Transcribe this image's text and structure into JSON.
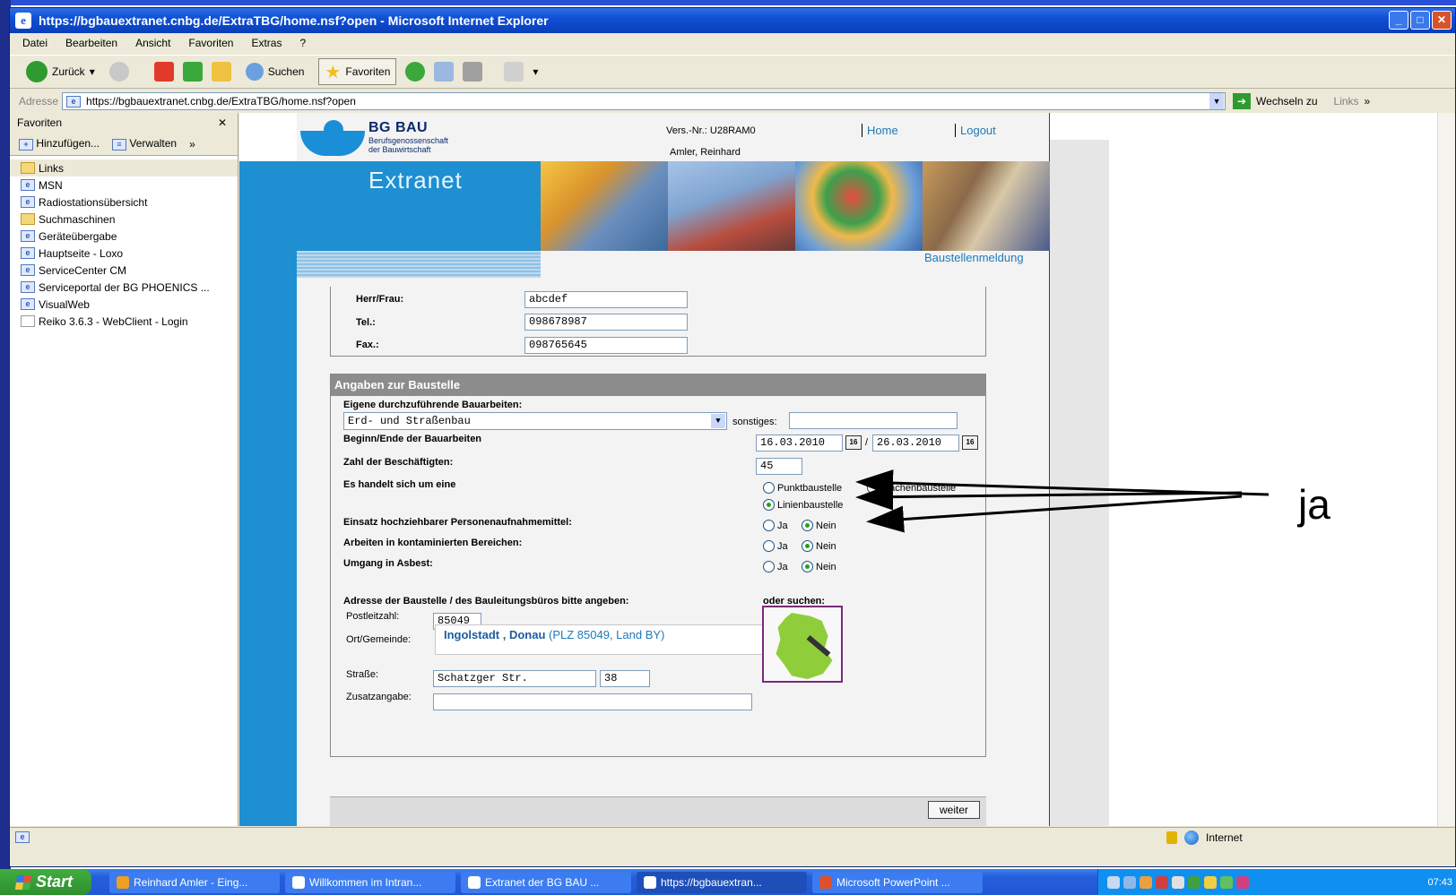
{
  "window": {
    "title": "https://bgbauextranet.cnbg.de/ExtraTBG/home.nsf?open - Microsoft Internet Explorer"
  },
  "menu": [
    "Datei",
    "Bearbeiten",
    "Ansicht",
    "Favoriten",
    "Extras",
    "?"
  ],
  "toolbar": {
    "back": "Zurück",
    "search": "Suchen",
    "favorites": "Favoriten"
  },
  "address": {
    "label": "Adresse",
    "url": "https://bgbauextranet.cnbg.de/ExtraTBG/home.nsf?open",
    "go": "Wechseln zu",
    "links": "Links"
  },
  "favorites_panel": {
    "title": "Favoriten",
    "add": "Hinzufügen...",
    "manage": "Verwalten",
    "items": [
      {
        "label": "Links",
        "icon": "folder-icon"
      },
      {
        "label": "MSN",
        "icon": "ie-page-icon"
      },
      {
        "label": "Radiostationsübersicht",
        "icon": "ie-page-icon"
      },
      {
        "label": "Suchmaschinen",
        "icon": "folder-icon"
      },
      {
        "label": "Geräteübergabe",
        "icon": "ie-page-icon"
      },
      {
        "label": "Hauptseite - Loxo",
        "icon": "ie-page-icon"
      },
      {
        "label": "ServiceCenter CM",
        "icon": "ie-page-icon"
      },
      {
        "label": "Serviceportal der BG PHOENICS ...",
        "icon": "ie-page-icon"
      },
      {
        "label": "VisualWeb",
        "icon": "ie-page-icon"
      },
      {
        "label": "Reiko 3.6.3 - WebClient - Login",
        "icon": "reiko-icon"
      }
    ]
  },
  "page": {
    "logo": {
      "name": "BG BAU",
      "sub1": "Berufsgenossenschaft",
      "sub2": "der Bauwirtschaft"
    },
    "version": "Vers.-Nr.: U28RAM0",
    "user": "Amler, Reinhard",
    "nav_home": "Home",
    "nav_logout": "Logout",
    "extranet": "Extranet",
    "section_link": "Baustellenmeldung",
    "contact": {
      "herr_label": "Herr/Frau:",
      "herr_value": "abcdef",
      "tel_label": "Tel.:",
      "tel_value": "098678987",
      "fax_label": "Fax.:",
      "fax_value": "098765645"
    },
    "site": {
      "heading": "Angaben zur Baustelle",
      "works_label": "Eigene durchzuführende Bauarbeiten:",
      "works_value": "Erd- und Straßenbau",
      "other_label": "sonstiges:",
      "dates_label": "Beginn/Ende der Bauarbeiten",
      "date_start": "16.03.2010",
      "date_sep": "/",
      "date_end": "26.03.2010",
      "employees_label": "Zahl der Beschäftigten:",
      "employees_value": "45",
      "type_label": "Es handelt sich um eine",
      "type_punkt": "Punktbaustelle",
      "type_flaechen": "Flächenbaustelle",
      "type_linien": "Linienbaustelle",
      "q1_label": "Einsatz hochziehbarer Personenaufnahmemittel:",
      "q2_label": "Arbeiten in kontaminierten Bereichen:",
      "q3_label": "Umgang in Asbest:",
      "ja": "Ja",
      "nein": "Nein",
      "address_label": "Adresse der Baustelle / des Bauleitungsbüros bitte angeben:",
      "search_label": "oder suchen:",
      "plz_label": "Postleitzahl:",
      "plz_value": "85049",
      "ort_label": "Ort/Gemeinde:",
      "suggest_city": "Ingolstadt , Donau",
      "suggest_detail": "(PLZ 85049, Land BY)",
      "street_label": "Straße:",
      "street_value": "Schatzger Str.",
      "number_value": "38",
      "extra_label": "Zusatzangabe:",
      "next_button": "weiter"
    }
  },
  "status": {
    "zone": "Internet"
  },
  "taskbar": {
    "start": "Start",
    "items": [
      "Reinhard Amler - Eing...",
      "Willkommen im Intran...",
      "Extranet der BG BAU ...",
      "https://bgbauextran...",
      "Microsoft PowerPoint ..."
    ],
    "clock": "07:43"
  },
  "annotation": {
    "text": "ja"
  }
}
